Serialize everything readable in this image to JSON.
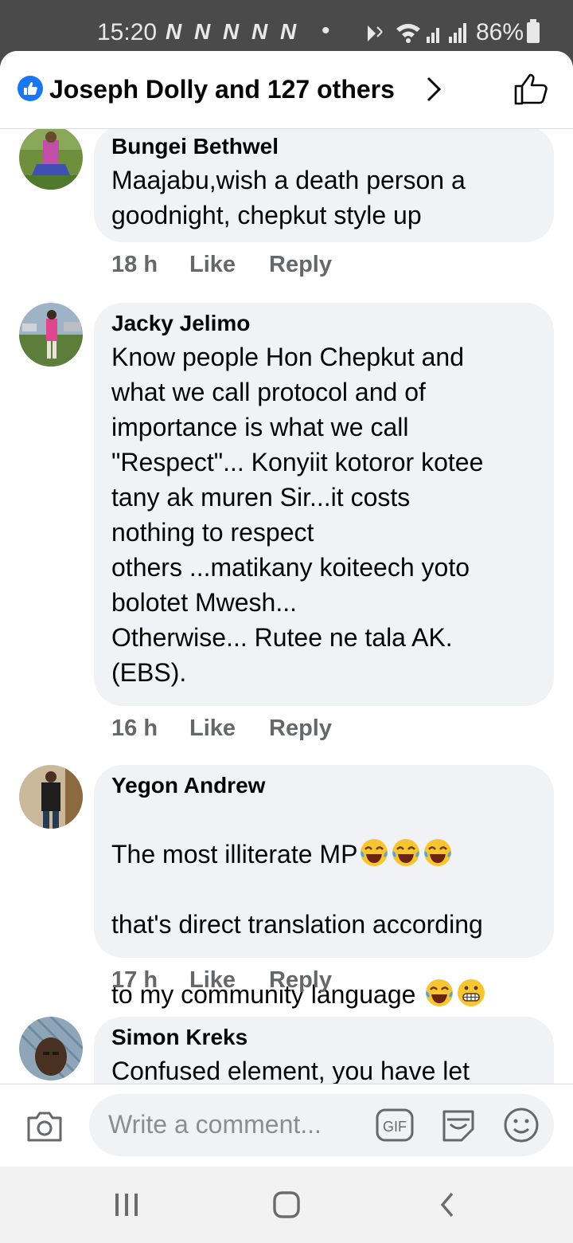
{
  "status_bar": {
    "time": "15:20",
    "notif_glyphs": "N N N N N",
    "dot": "•",
    "battery": "86%"
  },
  "header": {
    "title": "Joseph Dolly and 127 others",
    "icons": [
      "like-badge-icon",
      "chevron-right-icon",
      "thumbs-up-icon"
    ],
    "accent_color": "#1877f2"
  },
  "comments": [
    {
      "author": "Bungei Bethwel",
      "text": "Maajabu,wish a death person a\ngoodnight, chepkut style up",
      "time": "18 h",
      "like": "Like",
      "reply": "Reply"
    },
    {
      "author": "Jacky Jelimo",
      "text": "Know people Hon Chepkut and\nwhat we call protocol and of\nimportance is what we call\n\"Respect\"... Konyiit kotoror kotee\ntany ak muren Sir...it costs\nnothing to respect\nothers ...matikany koiteech yoto\nbolotet Mwesh...\nOtherwise... Rutee ne tala AK.\n(EBS).",
      "time": "16 h",
      "like": "Like",
      "reply": "Reply"
    },
    {
      "author": "Yegon Andrew",
      "line1": "The most illiterate MP",
      "line2": "that's direct translation according",
      "line3": "to my community language ",
      "time": "17 h",
      "like": "Like",
      "reply": "Reply",
      "emojis": [
        "tears-of-joy-emoji",
        "grimacing-emoji"
      ]
    },
    {
      "author": "Simon Kreks",
      "text": "Confused element, you have let"
    }
  ],
  "composer": {
    "placeholder": "Write a comment...",
    "icons": [
      "camera-icon",
      "gif-icon",
      "sticker-icon",
      "smiley-icon"
    ]
  },
  "nav_bar": {
    "icons": [
      "recent-apps-icon",
      "home-icon",
      "back-icon"
    ]
  }
}
